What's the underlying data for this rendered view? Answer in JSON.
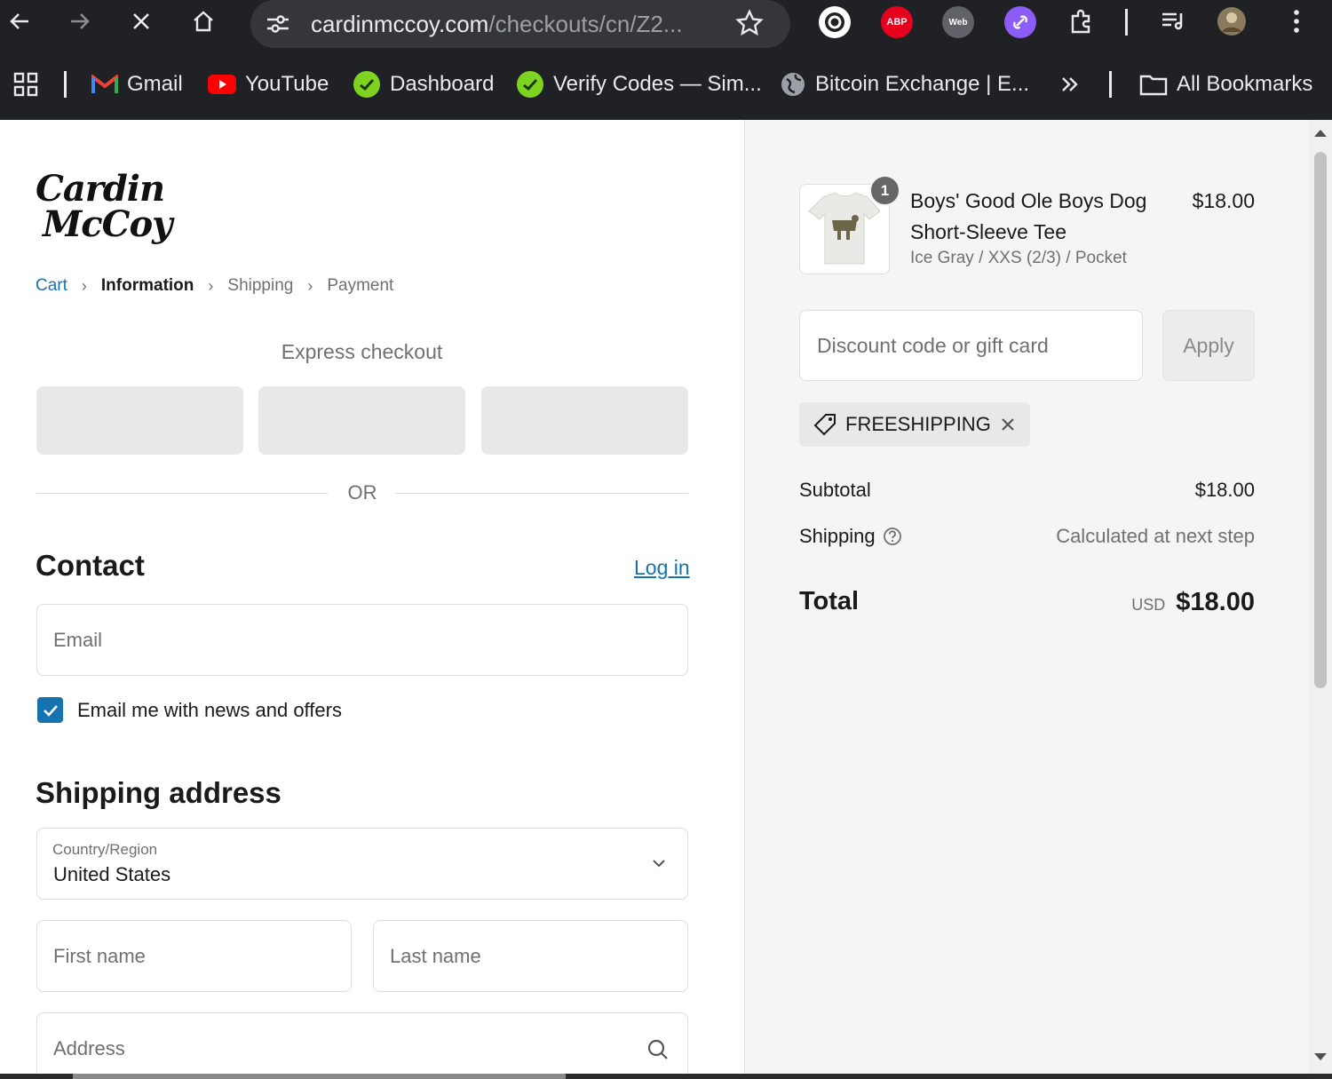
{
  "browser": {
    "url_host": "cardinmccoy.com",
    "url_path": "/checkouts/cn/Z2...",
    "extensions": [
      {
        "name": "grammarly-extension",
        "text": "",
        "color": "#15c39a"
      },
      {
        "name": "adblock-plus-extension",
        "text": "ABP",
        "color": "#e7001d"
      },
      {
        "name": "web-extension",
        "text": "Web",
        "color": "#5f6368"
      },
      {
        "name": "purple-extension",
        "text": "",
        "color": "#8b5cf6"
      }
    ],
    "bookmarks": [
      {
        "label": "Gmail",
        "icon": "gmail-icon"
      },
      {
        "label": "YouTube",
        "icon": "youtube-icon"
      },
      {
        "label": "Dashboard",
        "icon": "dashboard-icon"
      },
      {
        "label": "Verify Codes — Sim...",
        "icon": "verify-icon"
      },
      {
        "label": "Bitcoin Exchange | E...",
        "icon": "globe-icon"
      }
    ],
    "all_bookmarks": "All Bookmarks"
  },
  "checkout": {
    "logo_line1": "Cardin",
    "logo_line2": "McCoy",
    "breadcrumb": [
      "Cart",
      "Information",
      "Shipping",
      "Payment"
    ],
    "express_title": "Express checkout",
    "or_text": "OR",
    "contact_title": "Contact",
    "login_label": "Log in",
    "email_placeholder": "Email",
    "newsletter_label": "Email me with news and offers",
    "newsletter_checked": true,
    "shipping_title": "Shipping address",
    "country_label": "Country/Region",
    "country_value": "United States",
    "first_name_placeholder": "First name",
    "last_name_placeholder": "Last name",
    "address_placeholder": "Address"
  },
  "summary": {
    "quantity": "1",
    "product_line1": "Boys' Good Ole Boys Dog",
    "product_line2": "Short-Sleeve Tee",
    "variant": "Ice Gray / XXS (2/3) / Pocket",
    "price": "$18.00",
    "discount_placeholder": "Discount code or gift card",
    "apply_label": "Apply",
    "discount_code": "FREESHIPPING",
    "subtotal_label": "Subtotal",
    "subtotal_value": "$18.00",
    "shipping_label": "Shipping",
    "shipping_value": "Calculated at next step",
    "total_label": "Total",
    "total_currency": "USD",
    "total_value": "$18.00"
  },
  "colors": {
    "accent": "#1773b0",
    "chrome_bg": "#202124",
    "summary_bg": "#f5f5f5"
  }
}
